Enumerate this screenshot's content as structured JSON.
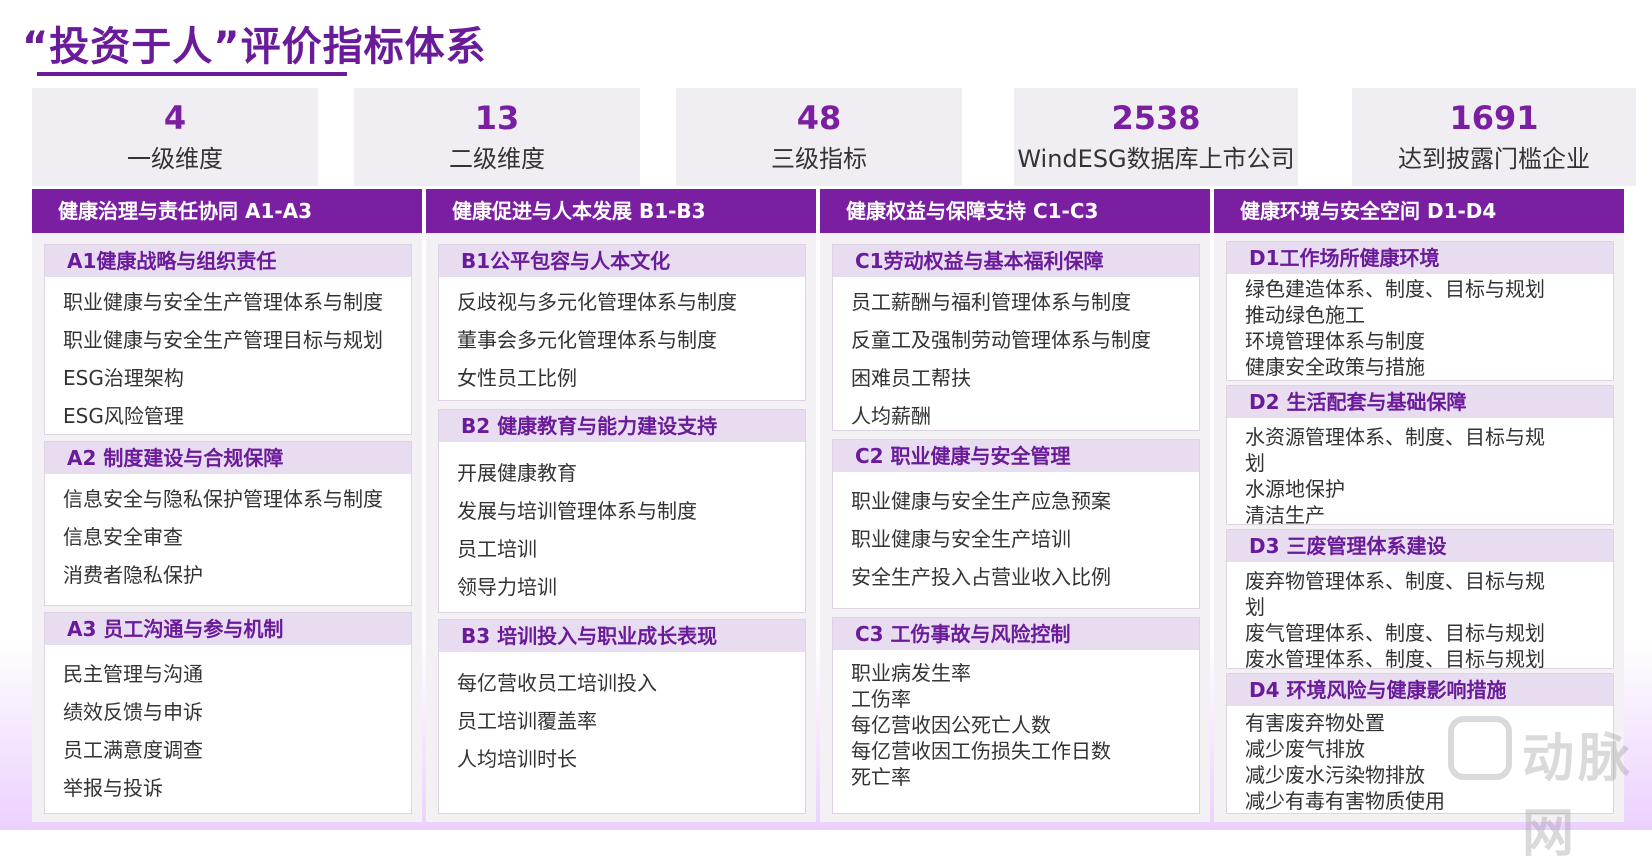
{
  "title": "“投资于人”评价指标体系",
  "stats": [
    {
      "number": "4",
      "label": "一级维度"
    },
    {
      "number": "13",
      "label": "二级维度"
    },
    {
      "number": "48",
      "label": "三级指标"
    },
    {
      "number": "2538",
      "label": "WindESG数据库上市公司"
    },
    {
      "number": "1691",
      "label": "达到披露门槛企业"
    }
  ],
  "columns": [
    {
      "header": "健康治理与责任协同  A1-A3",
      "sections": [
        {
          "title": "A1健康战略与组织责任",
          "items": [
            "职业健康与安全生产管理体系与制度",
            "职业健康与安全生产管理目标与规划",
            "ESG治理架构",
            "ESG风险管理"
          ]
        },
        {
          "title": "A2 制度建设与合规保障",
          "items": [
            "信息安全与隐私保护管理体系与制度",
            "信息安全审查",
            "消费者隐私保护"
          ]
        },
        {
          "title": "A3 员工沟通与参与机制",
          "items": [
            "民主管理与沟通",
            "绩效反馈与申诉",
            "员工满意度调查",
            "举报与投诉"
          ]
        }
      ]
    },
    {
      "header": "健康促进与人本发展  B1-B3",
      "sections": [
        {
          "title": "B1公平包容与人本文化",
          "items": [
            "反歧视与多元化管理体系与制度",
            "董事会多元化管理体系与制度",
            "女性员工比例"
          ]
        },
        {
          "title": "B2 健康教育与能力建设支持",
          "items": [
            "开展健康教育",
            "发展与培训管理体系与制度",
            "员工培训",
            "领导力培训"
          ]
        },
        {
          "title": "B3 培训投入与职业成长表现",
          "items": [
            "每亿营收员工培训投入",
            "员工培训覆盖率",
            "人均培训时长"
          ]
        }
      ]
    },
    {
      "header": "健康权益与保障支持  C1-C3",
      "sections": [
        {
          "title": "C1劳动权益与基本福利保障",
          "items": [
            "员工薪酬与福利管理体系与制度",
            "反童工及强制劳动管理体系与制度",
            "困难员工帮扶",
            "人均薪酬"
          ]
        },
        {
          "title": "C2 职业健康与安全管理",
          "items": [
            "职业健康与安全生产应急预案",
            "职业健康与安全生产培训",
            "安全生产投入占营业收入比例"
          ]
        },
        {
          "title": "C3 工伤事故与风险控制",
          "items": [
            "职业病发生率",
            "工伤率",
            "每亿营收因公死亡人数",
            "每亿营收因工伤损失工作日数",
            "死亡率"
          ]
        }
      ]
    },
    {
      "header": "健康环境与安全空间  D1-D4",
      "sections": [
        {
          "title": "D1工作场所健康环境",
          "items": [
            "绿色建造体系、制度、目标与规划",
            "推动绿色施工",
            "环境管理体系与制度",
            "健康安全政策与措施"
          ]
        },
        {
          "title": "D2 生活配套与基础保障",
          "items": [
            "水资源管理体系、制度、目标与规",
            "划",
            "水源地保护",
            "清洁生产"
          ]
        },
        {
          "title": "D3 三废管理体系建设",
          "items": [
            "废弃物管理体系、制度、目标与规",
            "划",
            "废气管理体系、制度、目标与规划",
            "废水管理体系、制度、目标与规划"
          ]
        },
        {
          "title": "D4 环境风险与健康影响措施",
          "items": [
            "有害废弃物处置",
            "减少废气排放",
            "减少废水污染物排放",
            "减少有毒有害物质使用"
          ]
        }
      ]
    }
  ],
  "watermark": {
    "text": "动脉网"
  }
}
